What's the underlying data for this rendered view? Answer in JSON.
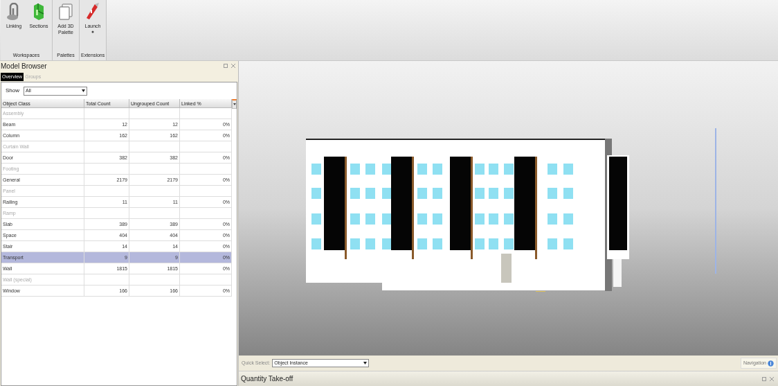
{
  "ribbon": {
    "groups": [
      {
        "label": "Workspaces",
        "buttons": [
          {
            "kind": "linking",
            "label": "Linking"
          },
          {
            "kind": "sections",
            "label": "Sections"
          }
        ]
      },
      {
        "label": "Palettes",
        "buttons": [
          {
            "kind": "palette",
            "label": "Add 3D\nPalette"
          }
        ]
      },
      {
        "label": "Extensions",
        "buttons": [
          {
            "kind": "launch",
            "label": "Launch",
            "dropdown": true
          }
        ]
      }
    ]
  },
  "model_browser": {
    "title": "Model Browser",
    "tabs": [
      {
        "label": "Overview",
        "selected": true
      },
      {
        "label": "Groups",
        "selected": false
      }
    ],
    "show": {
      "label": "Show",
      "value": "All"
    },
    "table": {
      "columns": [
        "Object Class",
        "Total Count",
        "Ungrouped Count",
        "Linked %"
      ],
      "rows": [
        {
          "kind": "category",
          "name": "Assembly",
          "selected": false
        },
        {
          "kind": "item",
          "name": "Beam",
          "total": "12",
          "ungrouped": "12",
          "linked": "0%",
          "selected": false
        },
        {
          "kind": "item",
          "name": "Column",
          "total": "162",
          "ungrouped": "162",
          "linked": "0%",
          "selected": false
        },
        {
          "kind": "category",
          "name": "Curtain Wall",
          "selected": false
        },
        {
          "kind": "item",
          "name": "Door",
          "total": "382",
          "ungrouped": "382",
          "linked": "0%",
          "selected": false
        },
        {
          "kind": "category",
          "name": "Footing",
          "selected": false
        },
        {
          "kind": "item",
          "name": "General",
          "total": "2179",
          "ungrouped": "2179",
          "linked": "0%",
          "selected": false
        },
        {
          "kind": "category",
          "name": "Panel",
          "selected": false
        },
        {
          "kind": "item",
          "name": "Railing",
          "total": "11",
          "ungrouped": "11",
          "linked": "0%",
          "selected": false
        },
        {
          "kind": "category",
          "name": "Ramp",
          "selected": false
        },
        {
          "kind": "item",
          "name": "Slab",
          "total": "389",
          "ungrouped": "389",
          "linked": "0%",
          "selected": false
        },
        {
          "kind": "item",
          "name": "Space",
          "total": "404",
          "ungrouped": "404",
          "linked": "0%",
          "selected": false
        },
        {
          "kind": "item",
          "name": "Stair",
          "total": "14",
          "ungrouped": "14",
          "linked": "0%",
          "selected": false
        },
        {
          "kind": "item",
          "name": "Transport",
          "total": "9",
          "ungrouped": "9",
          "linked": "0%",
          "selected": true
        },
        {
          "kind": "item",
          "name": "Wall",
          "total": "1815",
          "ungrouped": "1815",
          "linked": "0%",
          "selected": false
        },
        {
          "kind": "category",
          "name": "Wall (special)",
          "selected": false
        },
        {
          "kind": "item",
          "name": "Window",
          "total": "166",
          "ungrouped": "166",
          "linked": "0%",
          "selected": false
        }
      ]
    }
  },
  "viewport": {
    "quick_select": {
      "label": "Quick Select:",
      "value": "Object Instance"
    },
    "navigation": "Navigation"
  },
  "quantity_takeoff": {
    "title": "Quantity Take-off"
  }
}
